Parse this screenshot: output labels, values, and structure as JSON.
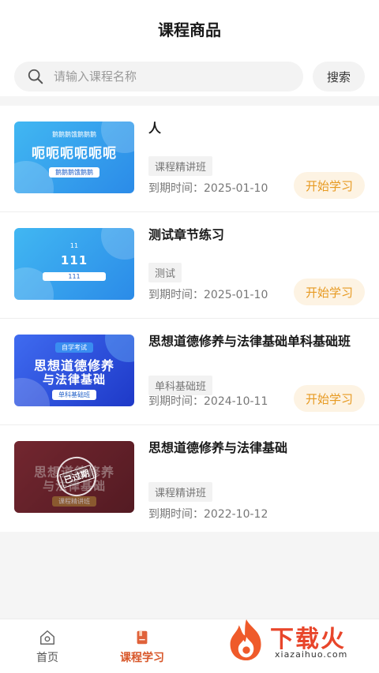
{
  "header": {
    "title": "课程商品"
  },
  "search": {
    "placeholder": "请输入课程名称",
    "button_label": "搜索"
  },
  "courses": [
    {
      "name": "人",
      "tag": "课程精讲班",
      "expire": "到期时间：2025-01-10",
      "button": "开始学习",
      "thumb": {
        "top": "鹅鹅鹅饿鹅鹅鹅",
        "big": "呃呃呃呃呃呃",
        "bottom": "鹅鹅鹅饿鹅鹅"
      }
    },
    {
      "name": "测试章节练习",
      "tag": "测试",
      "expire": "到期时间：2025-01-10",
      "button": "开始学习",
      "thumb": {
        "top": "11",
        "big": "111",
        "bottom": "111"
      }
    },
    {
      "name": "思想道德修养与法律基础单科基础班",
      "tag": "单科基础班",
      "expire": "到期时间：2024-10-11",
      "button": "开始学习",
      "thumb": {
        "top": "自学考试",
        "big1": "思想道德修养",
        "big2": "与法律基础",
        "bottom": "单科基础班"
      }
    },
    {
      "name": "思想道德修养与法律基础",
      "tag": "课程精讲班",
      "expire": "到期时间：2022-10-12",
      "thumb": {
        "big1": "思想道德修养",
        "big2": "与法律基础",
        "bottom": "课程精讲班",
        "stamp": "已过期"
      }
    }
  ],
  "tabbar": {
    "home": {
      "label": "首页",
      "icon": "home-icon"
    },
    "study": {
      "label": "课程学习",
      "icon": "book-icon"
    }
  },
  "watermark": {
    "logo": "下载火",
    "url": "xiazaihuo.com"
  },
  "colors": {
    "accent": "#e79a22",
    "active_tab": "#d8572a",
    "watermark": "#e8452a"
  }
}
